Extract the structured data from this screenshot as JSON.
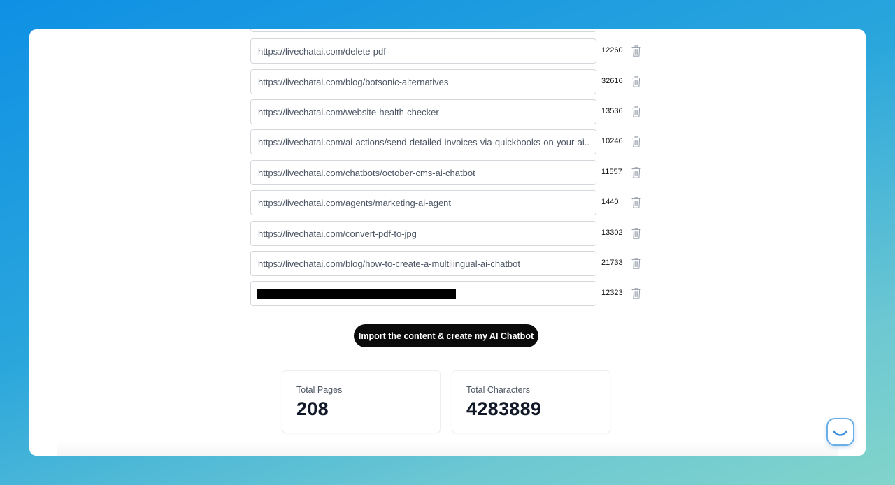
{
  "rows": [
    {
      "url": "https://livechatai.com/delete-pdf",
      "chars": "12260"
    },
    {
      "url": "https://livechatai.com/blog/botsonic-alternatives",
      "chars": "32616"
    },
    {
      "url": "https://livechatai.com/website-health-checker",
      "chars": "13536"
    },
    {
      "url": "https://livechatai.com/ai-actions/send-detailed-invoices-via-quickbooks-on-your-ai...",
      "chars": "10246"
    },
    {
      "url": "https://livechatai.com/chatbots/october-cms-ai-chatbot",
      "chars": "11557"
    },
    {
      "url": "https://livechatai.com/agents/marketing-ai-agent",
      "chars": "1440"
    },
    {
      "url": "https://livechatai.com/convert-pdf-to-jpg",
      "chars": "13302"
    },
    {
      "url": "https://livechatai.com/blog/how-to-create-a-multilingual-ai-chatbot",
      "chars": "21733"
    },
    {
      "url": "",
      "chars": "12323",
      "redacted": true
    }
  ],
  "cta": {
    "label": "Import the content & create my AI Chatbot"
  },
  "stats": {
    "pages": {
      "label": "Total Pages",
      "value": "208"
    },
    "characters": {
      "label": "Total Characters",
      "value": "4283889"
    }
  },
  "icons": {
    "delete": "trash-icon",
    "chat": "chat-widget-icon"
  },
  "colors": {
    "cta_bg": "#0b0b0b",
    "chat_accent": "#6aaee8"
  }
}
